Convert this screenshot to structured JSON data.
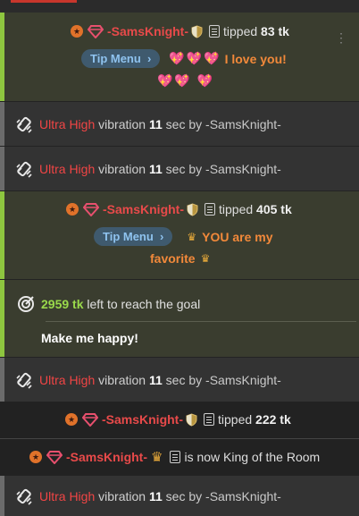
{
  "chat": {
    "tip1": {
      "username": "-SamsKnight-",
      "tipped_label": "tipped",
      "amount": "83 tk",
      "tip_menu_label": "Tip Menu",
      "hearts_before": "💖💖💖",
      "message": "I love you!",
      "hearts_after": "💖💖 💖"
    },
    "vibration": {
      "level": "Ultra High",
      "label": "vibration",
      "seconds": "11",
      "unit": "sec",
      "by": "by",
      "username": "-SamsKnight-"
    },
    "tip2": {
      "username": "-SamsKnight-",
      "tipped_label": "tipped",
      "amount": "405 tk",
      "tip_menu_label": "Tip Menu",
      "message_line1": "YOU are my",
      "message_line2": "favorite"
    },
    "goal": {
      "amount": "2959 tk",
      "text": "left to reach the goal",
      "description": "Make me happy!"
    },
    "tip3": {
      "username": "-SamsKnight-",
      "tipped_label": "tipped",
      "amount": "222 tk"
    },
    "king": {
      "username": "-SamsKnight-",
      "text": "is now King of the Room"
    }
  },
  "colors": {
    "tip_background": "#3a3d2f",
    "tip_accent": "#8ec63f",
    "username_red": "#e84a4a",
    "message_orange": "#f2893a",
    "tip_menu_blue": "#8fc3ef",
    "goal_green": "#9ad94b"
  }
}
